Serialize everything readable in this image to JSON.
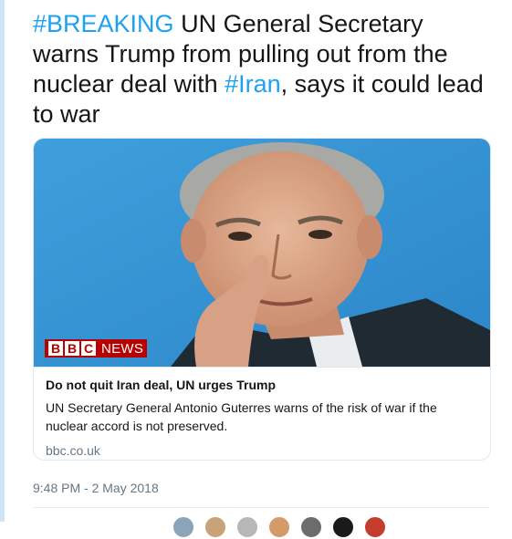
{
  "tweet": {
    "segments": [
      {
        "text": "#BREAKING",
        "hashtag": true
      },
      {
        "text": " UN General Secretary warns Trump from pulling out from the nuclear deal with ",
        "hashtag": false
      },
      {
        "text": "#Iran",
        "hashtag": true
      },
      {
        "text": ", says it could lead to war",
        "hashtag": false
      }
    ],
    "timestamp": "9:48 PM - 2 May 2018"
  },
  "card": {
    "logo_letters": [
      "B",
      "B",
      "C"
    ],
    "logo_word": "NEWS",
    "title": "Do not quit Iran deal, UN urges Trump",
    "description": "UN Secretary General Antonio Guterres warns of the risk of war if the nuclear accord is not preserved.",
    "domain": "bbc.co.uk"
  },
  "colors": {
    "accent": "#1da1f2",
    "bbc_red": "#b80000",
    "muted": "#657786",
    "text": "#14171a"
  },
  "likers": [
    {
      "color": "#8aa4b8"
    },
    {
      "color": "#c9a27a"
    },
    {
      "color": "#b7b7b7"
    },
    {
      "color": "#d59a6a"
    },
    {
      "color": "#6c6c6c"
    },
    {
      "color": "#1a1a1a"
    },
    {
      "color": "#c43c2c"
    }
  ]
}
